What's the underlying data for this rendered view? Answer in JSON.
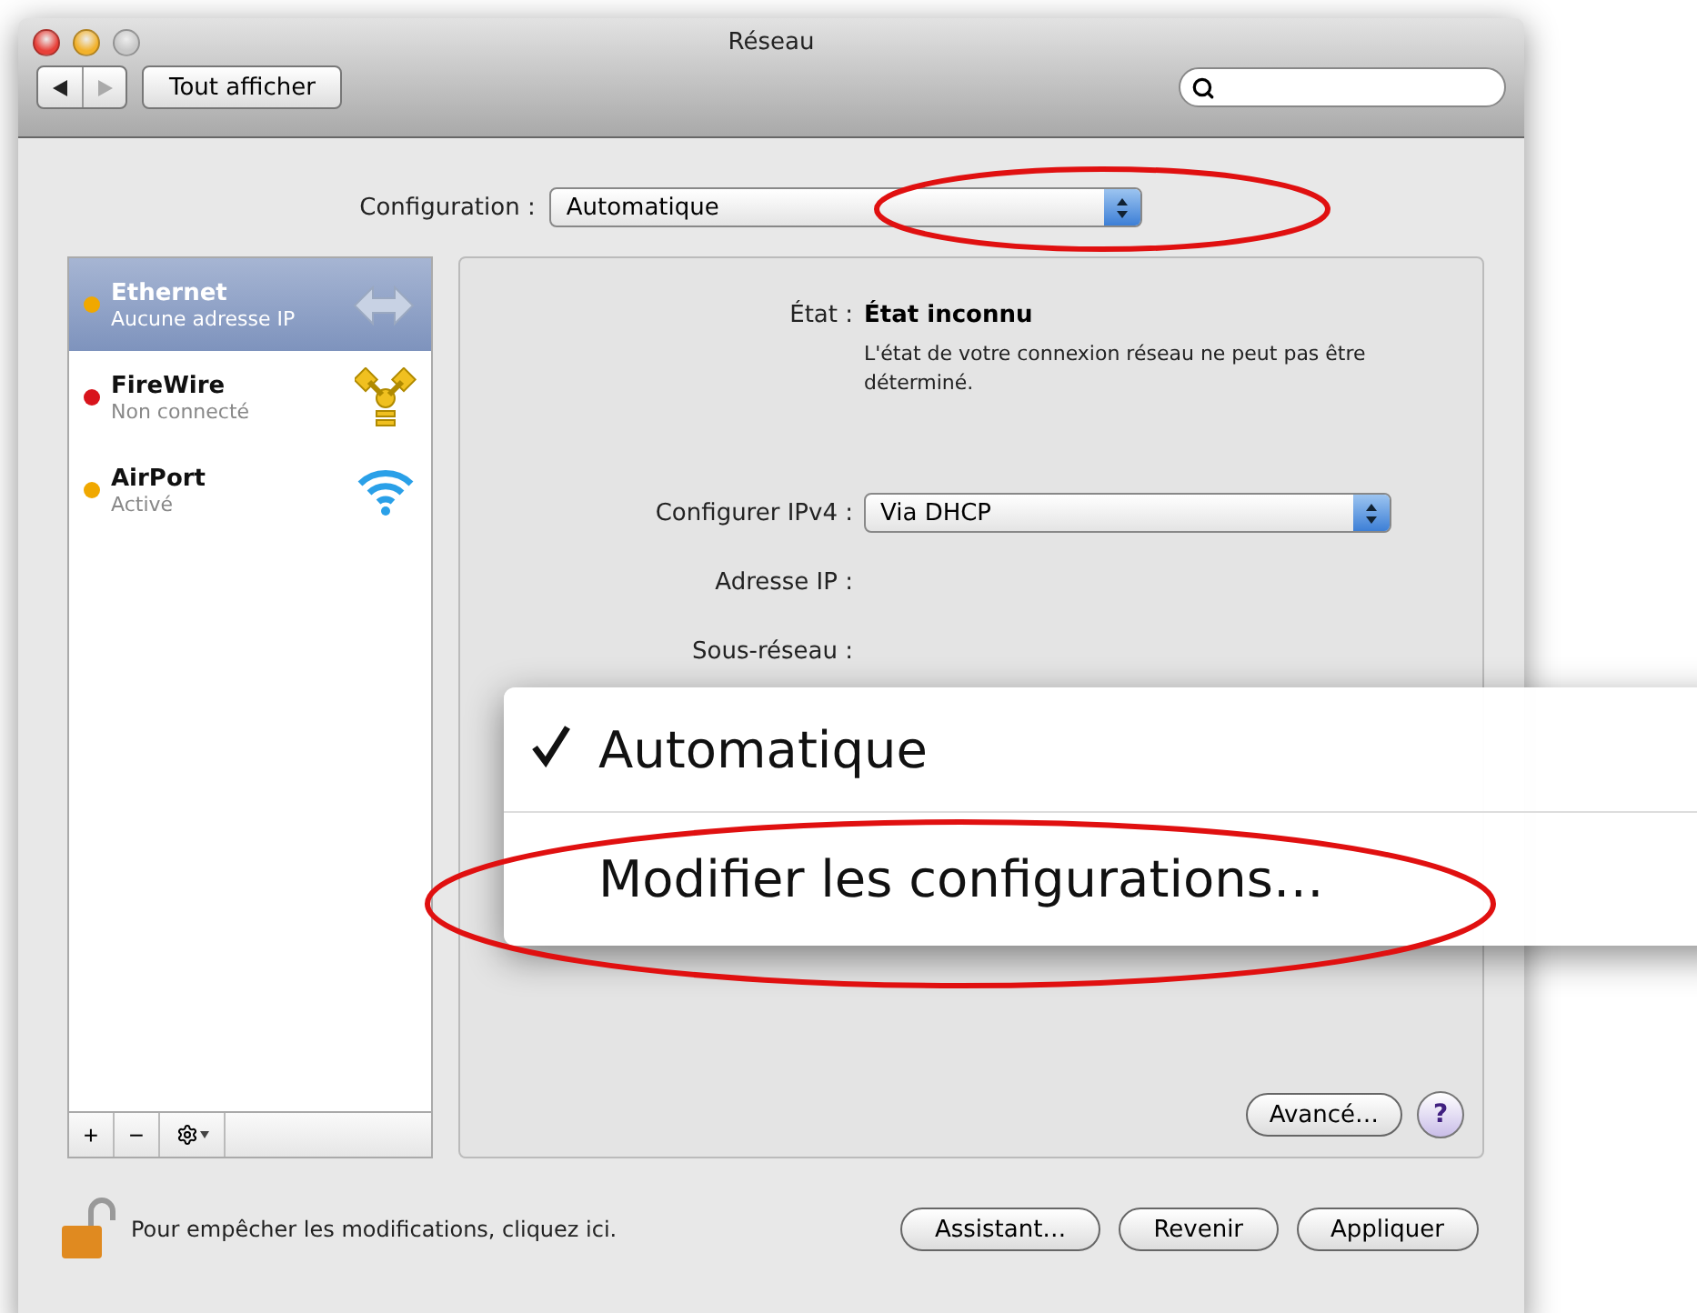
{
  "window": {
    "title": "Réseau"
  },
  "toolbar": {
    "show_all": "Tout afficher"
  },
  "configuration": {
    "label": "Configuration :",
    "value": "Automatique"
  },
  "services": [
    {
      "name": "Ethernet",
      "status": "Aucune adresse IP",
      "color": "#f0a800",
      "selected": true,
      "kind": "ethernet"
    },
    {
      "name": "FireWire",
      "status": "Non connecté",
      "color": "#d8141c",
      "selected": false,
      "kind": "firewire"
    },
    {
      "name": "AirPort",
      "status": "Activé",
      "color": "#f0a800",
      "selected": false,
      "kind": "wifi"
    }
  ],
  "service_actions": {
    "add": "+",
    "remove": "−"
  },
  "details": {
    "status_label": "État :",
    "status_value": "État inconnu",
    "status_description": "L'état de votre connexion réseau ne peut pas être déterminé.",
    "fields": [
      {
        "label": "Configurer IPv4 :",
        "kind": "popup",
        "value": "Via DHCP"
      },
      {
        "label": "Adresse IP :",
        "kind": "text"
      },
      {
        "label": "Sous-réseau :",
        "kind": "text"
      }
    ],
    "advanced": "Avancé…",
    "help": "?"
  },
  "footer": {
    "lock_text": "Pour empêcher les modifications, cliquez ici.",
    "buttons": [
      "Assistant…",
      "Revenir",
      "Appliquer"
    ]
  },
  "configuration_menu": [
    {
      "label": "Automatique",
      "checked": true
    },
    {
      "label": "Modifier les configurations…",
      "checked": false
    }
  ]
}
